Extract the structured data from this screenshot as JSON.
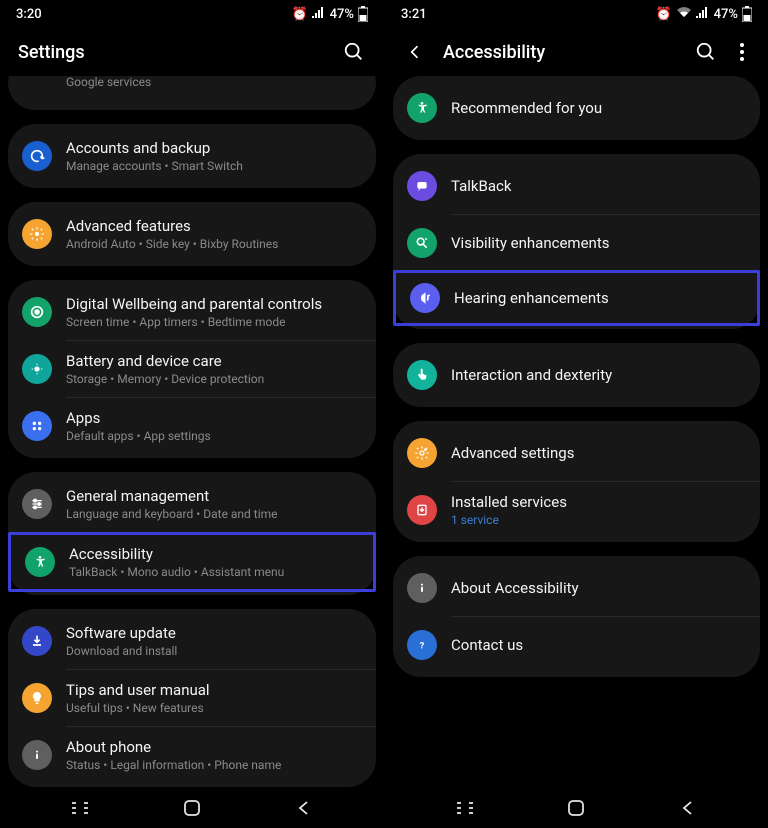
{
  "left": {
    "status": {
      "time": "3:20",
      "battery": "47%"
    },
    "header": {
      "title": "Settings"
    },
    "items": {
      "google": {
        "title": "",
        "sub": "Google services"
      },
      "accounts": {
        "title": "Accounts and backup",
        "sub": "Manage accounts  •  Smart Switch"
      },
      "advanced": {
        "title": "Advanced features",
        "sub": "Android Auto  •  Side key  •  Bixby Routines"
      },
      "wellbeing": {
        "title": "Digital Wellbeing and parental controls",
        "sub": "Screen time  •  App timers  •  Bedtime mode"
      },
      "battery": {
        "title": "Battery and device care",
        "sub": "Storage  •  Memory  •  Device protection"
      },
      "apps": {
        "title": "Apps",
        "sub": "Default apps  •  App settings"
      },
      "general": {
        "title": "General management",
        "sub": "Language and keyboard  •  Date and time"
      },
      "accessibility": {
        "title": "Accessibility",
        "sub": "TalkBack  •  Mono audio  •  Assistant menu"
      },
      "software": {
        "title": "Software update",
        "sub": "Download and install"
      },
      "tips": {
        "title": "Tips and user manual",
        "sub": "Useful tips  •  New features"
      },
      "about": {
        "title": "About phone",
        "sub": "Status  •  Legal information  •  Phone name"
      }
    }
  },
  "right": {
    "status": {
      "time": "3:21",
      "battery": "47%"
    },
    "header": {
      "title": "Accessibility"
    },
    "items": {
      "recommended": {
        "title": "Recommended for you"
      },
      "talkback": {
        "title": "TalkBack"
      },
      "visibility": {
        "title": "Visibility enhancements"
      },
      "hearing": {
        "title": "Hearing enhancements"
      },
      "interaction": {
        "title": "Interaction and dexterity"
      },
      "advset": {
        "title": "Advanced settings"
      },
      "installed": {
        "title": "Installed services",
        "sub": "1 service"
      },
      "about": {
        "title": "About Accessibility"
      },
      "contact": {
        "title": "Contact us"
      }
    }
  },
  "colors": {
    "blue": "#1a5fd0",
    "darkblue": "#3547c9",
    "orange": "#f5a431",
    "green": "#12a36b",
    "teal": "#0fa59a",
    "teal2": "#0fb2a0",
    "bluegrid": "#3a6ff0",
    "grey": "#5f5f5f",
    "purple": "#6a4de0",
    "greencircle": "#12a36b",
    "bluevol": "#5a5ff0",
    "teal3": "#12b39a",
    "red": "#e04545",
    "grey2": "#5f5f5f",
    "bluecircle": "#2a6fd5"
  }
}
